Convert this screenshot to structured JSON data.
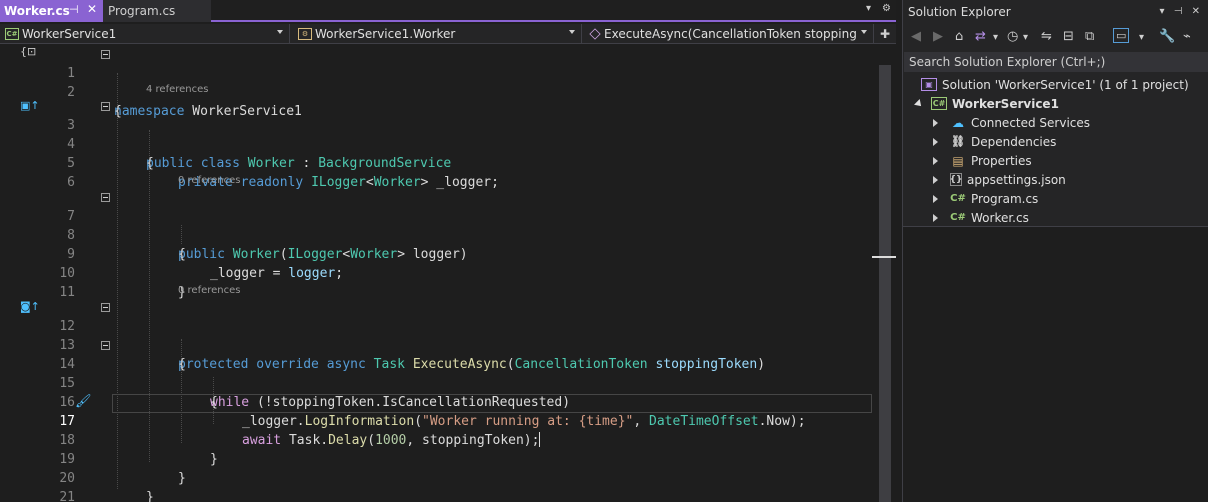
{
  "tabs": [
    {
      "label": "Worker.cs",
      "active": true
    },
    {
      "label": "Program.cs",
      "active": false
    }
  ],
  "navbar": {
    "project": "WorkerService1",
    "class": "WorkerService1.Worker",
    "member": "ExecuteAsync(CancellationToken stoppingToken)"
  },
  "code": {
    "line_numbers": [
      "1",
      "2",
      "3",
      "4",
      "5",
      "6",
      "7",
      "8",
      "9",
      "10",
      "11",
      "12",
      "13",
      "14",
      "15",
      "16",
      "17",
      "18",
      "19",
      "20",
      "21"
    ],
    "current_line": "17",
    "refs": {
      "class_refs": "4 references",
      "ctor_refs": "0 references",
      "exec_refs": "0 references"
    },
    "t": {
      "namespace_kw": "namespace",
      "namespace_name": " WorkerService1",
      "open_brace": "{",
      "close_brace": "}",
      "public_class": "public class",
      "worker": "Worker",
      "colon": " : ",
      "background_service": "BackgroundService",
      "private_readonly": "private readonly",
      "ilogger": "ILogger",
      "lt": "<",
      "gt": ">",
      "logger_field": " _logger;",
      "public": "public",
      "paren_open": "(",
      "logger_param": " logger)",
      "assign_lhs": "_logger",
      "assign_eq": " = ",
      "logger_var": "logger",
      "semicolon": ";",
      "protected_override_async": "protected override async",
      "task": "Task",
      "execute_async": "ExecuteAsync",
      "cancellation_token": "CancellationToken",
      "stopping_token": "stoppingToken",
      "paren_close": ")",
      "while": "while",
      "not_open": " (!",
      "is_cancel": "stoppingToken.IsCancellationRequested)",
      "logger_dot": "_logger.",
      "log_info": "LogInformation",
      "log_string": "\"Worker running at: {time}\"",
      "comma": ", ",
      "dto": "DateTimeOffset",
      "now": ".Now);",
      "await": "await",
      "task_dot": "Task.",
      "delay": "Delay",
      "num_1000": "1000",
      "stopping_close": "stoppingToken);"
    }
  },
  "solution_explorer": {
    "title": "Solution Explorer",
    "search_placeholder": "Search Solution Explorer (Ctrl+;)",
    "solution": "Solution 'WorkerService1' (1 of 1 project)",
    "project": "WorkerService1",
    "items": [
      {
        "label": "Connected Services",
        "icon": "cloud-icon"
      },
      {
        "label": "Dependencies",
        "icon": "dependencies-icon"
      },
      {
        "label": "Properties",
        "icon": "properties-icon"
      },
      {
        "label": "appsettings.json",
        "icon": "json-icon"
      },
      {
        "label": "Program.cs",
        "icon": "csharp-file-icon"
      },
      {
        "label": "Worker.cs",
        "icon": "csharp-file-icon"
      }
    ]
  },
  "colors": {
    "accent": "#8a63d2",
    "keyword": "#569cd6",
    "control": "#d8a0df",
    "type": "#4ec9b0",
    "method": "#dcdcaa",
    "string": "#d69d85",
    "number": "#b5cea8",
    "parameter": "#9cdcfe"
  }
}
